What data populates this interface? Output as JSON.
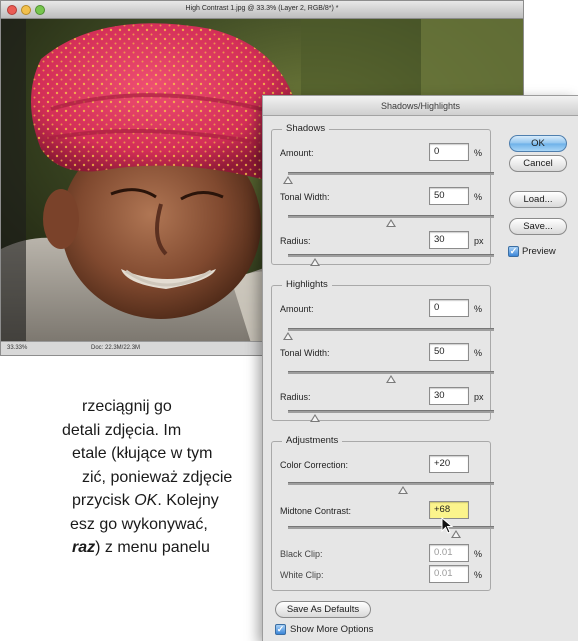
{
  "document_window": {
    "title": "High Contrast 1.jpg @ 33.3% (Layer 2, RGB/8*) *",
    "status_zoom": "33.33%",
    "status_doc": "Doc: 22.3M/22.3M"
  },
  "body_text": {
    "line1": "rzeciągnij go",
    "line2": "detali zdjęcia. Im",
    "line3": "etale (kłujące w tym",
    "line4": "zić, ponieważ zdjęcie",
    "line5_pre": "przycisk ",
    "line5_em": "OK",
    "line5_post": ". Kolejny",
    "line6": "esz go wykonywać,",
    "line7_em": "raz",
    "line7_post": ") z menu panelu"
  },
  "dialog": {
    "title": "Shadows/Highlights",
    "shadows": {
      "legend": "Shadows",
      "amount_label": "Amount:",
      "amount_value": "0",
      "amount_unit": "%",
      "tonal_label": "Tonal Width:",
      "tonal_value": "50",
      "tonal_unit": "%",
      "radius_label": "Radius:",
      "radius_value": "30",
      "radius_unit": "px"
    },
    "highlights": {
      "legend": "Highlights",
      "amount_label": "Amount:",
      "amount_value": "0",
      "amount_unit": "%",
      "tonal_label": "Tonal Width:",
      "tonal_value": "50",
      "tonal_unit": "%",
      "radius_label": "Radius:",
      "radius_value": "30",
      "radius_unit": "px"
    },
    "adjustments": {
      "legend": "Adjustments",
      "color_label": "Color Correction:",
      "color_value": "+20",
      "midtone_label": "Midtone Contrast:",
      "midtone_value": "+68",
      "black_label": "Black Clip:",
      "black_value": "0.01",
      "black_unit": "%",
      "white_label": "White Clip:",
      "white_value": "0.01",
      "white_unit": "%"
    },
    "buttons": {
      "ok": "OK",
      "cancel": "Cancel",
      "load": "Load...",
      "save": "Save...",
      "save_defaults": "Save As Defaults"
    },
    "preview_label": "Preview",
    "preview_checked": true,
    "show_more_label": "Show More Options",
    "show_more_checked": true,
    "slider_levels": {
      "shadows_amount": 0,
      "shadows_tonal_width": 50,
      "shadows_radius": 30,
      "highlights_amount": 0,
      "highlights_tonal_width": 50,
      "highlights_radius": 30,
      "color_correction": 20,
      "midtone_contrast": 68
    }
  },
  "colors": {
    "ok_button": "#6cb0e8",
    "highlighted_field": "#fbf48c",
    "turban": "#d8345a"
  }
}
